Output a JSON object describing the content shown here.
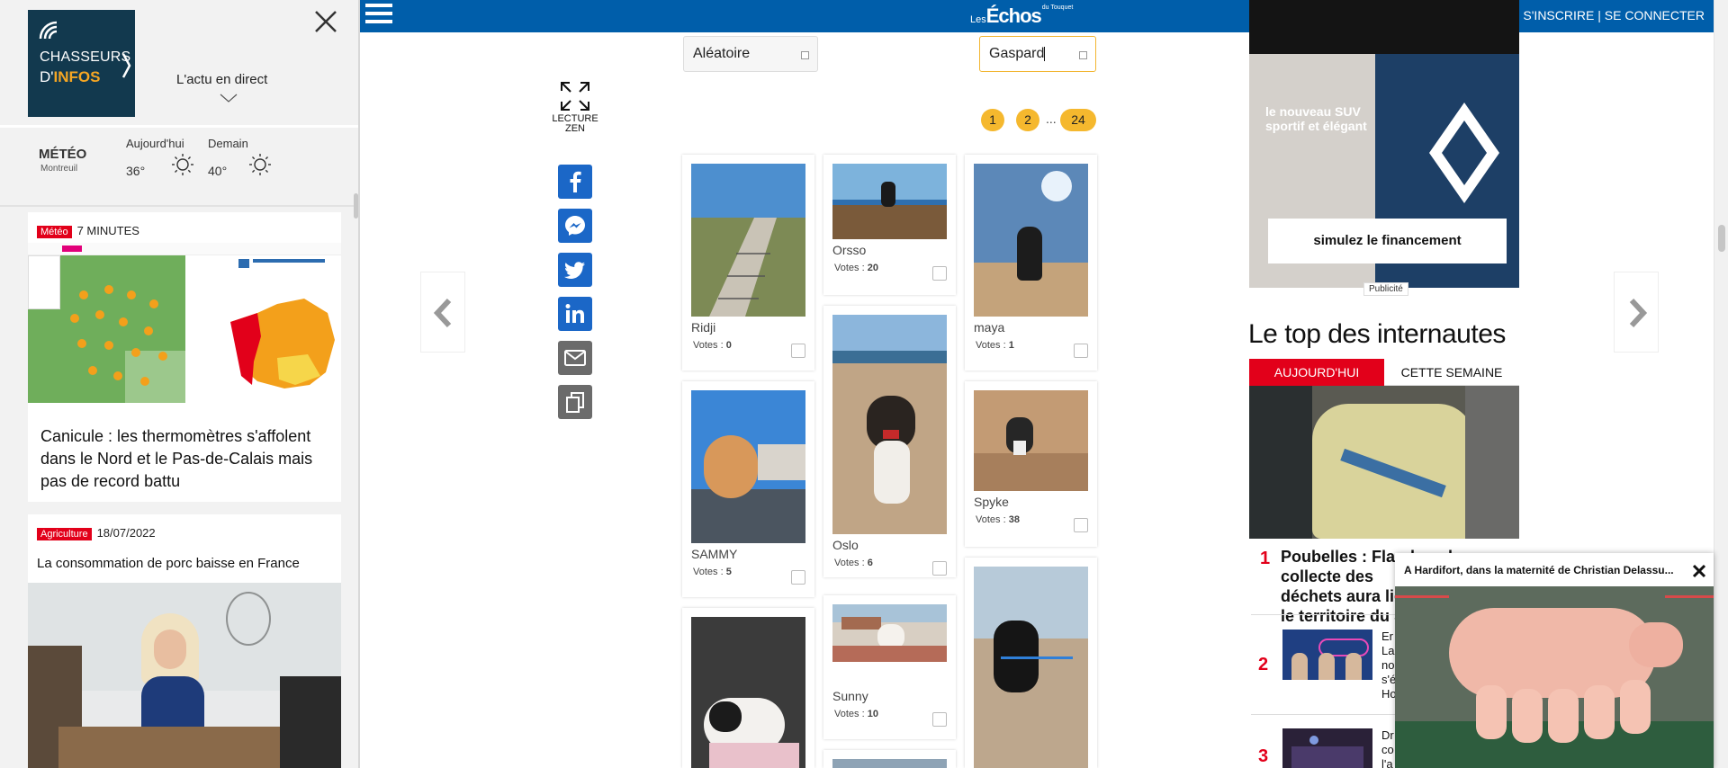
{
  "sidebar": {
    "logo_line1": "CHASSEURS",
    "logo_line2_prefix": "D'",
    "logo_line2_bold": "INFOS",
    "live_label": "L'actu en direct",
    "weather": {
      "title": "MÉTÉO",
      "city": "Montreuil",
      "today_label": "Aujourd'hui",
      "today_temp": "36°",
      "tomorrow_label": "Demain",
      "tomorrow_temp": "40°"
    },
    "cards": [
      {
        "tag": "Météo",
        "time": "7 MINUTES",
        "title": "Canicule : les thermomètres s'affolent dans le Nord et le Pas-de-Calais mais pas de record battu"
      },
      {
        "tag": "Agriculture",
        "time": "18/07/2022",
        "title": "La consommation de porc baisse en France"
      }
    ]
  },
  "topbar": {
    "brand_small": "Les",
    "brand": "Échos",
    "brand_sup": "du Touquet",
    "signup": "S'INSCRIRE",
    "separator": "|",
    "login": "SE CONNECTER"
  },
  "filters": {
    "sort_value": "Aléatoire",
    "name_value": "Gaspard"
  },
  "zen": {
    "line1": "LECTURE",
    "line2": "ZEN"
  },
  "pagination": {
    "pages": [
      "1",
      "2",
      "24"
    ],
    "ellipsis": "..."
  },
  "votes_label": "Votes :",
  "gallery": [
    {
      "name": "Ridji",
      "votes": "0"
    },
    {
      "name": "Orsso",
      "votes": "20"
    },
    {
      "name": "maya",
      "votes": "1"
    },
    {
      "name": "SAMMY",
      "votes": "5"
    },
    {
      "name": "Oslo",
      "votes": "6"
    },
    {
      "name": "Spyke",
      "votes": "38"
    },
    {
      "name": "Sunny",
      "votes": "10"
    }
  ],
  "ad": {
    "line1": "le nouveau SUV",
    "line2": "sportif et élégant",
    "cta": "simulez le financement",
    "label": "Publicité"
  },
  "top": {
    "title": "Le top des internautes",
    "tab_today": "AUJOURD'HUI",
    "tab_week": "CETTE SEMAINE",
    "items": [
      {
        "rank": "1",
        "line1": "Poubelles : Flandre... la collecte des",
        "line2": "déchets aura lieu ...",
        "line3": "le territoire du Si..."
      },
      {
        "rank": "2",
        "lines": [
          "Er",
          "La",
          "no",
          "s'é",
          "Ho"
        ]
      },
      {
        "rank": "3",
        "lines": [
          "Dr",
          "co",
          "l'a lô qui a lue"
        ]
      }
    ]
  },
  "video": {
    "title": "A Hardifort, dans la maternité de Christian Delassu..."
  },
  "colors": {
    "brand_blue": "#005eaa",
    "accent_red": "#e2001a",
    "pager_yellow": "#f5b82e",
    "logo_navy": "#12394e"
  }
}
